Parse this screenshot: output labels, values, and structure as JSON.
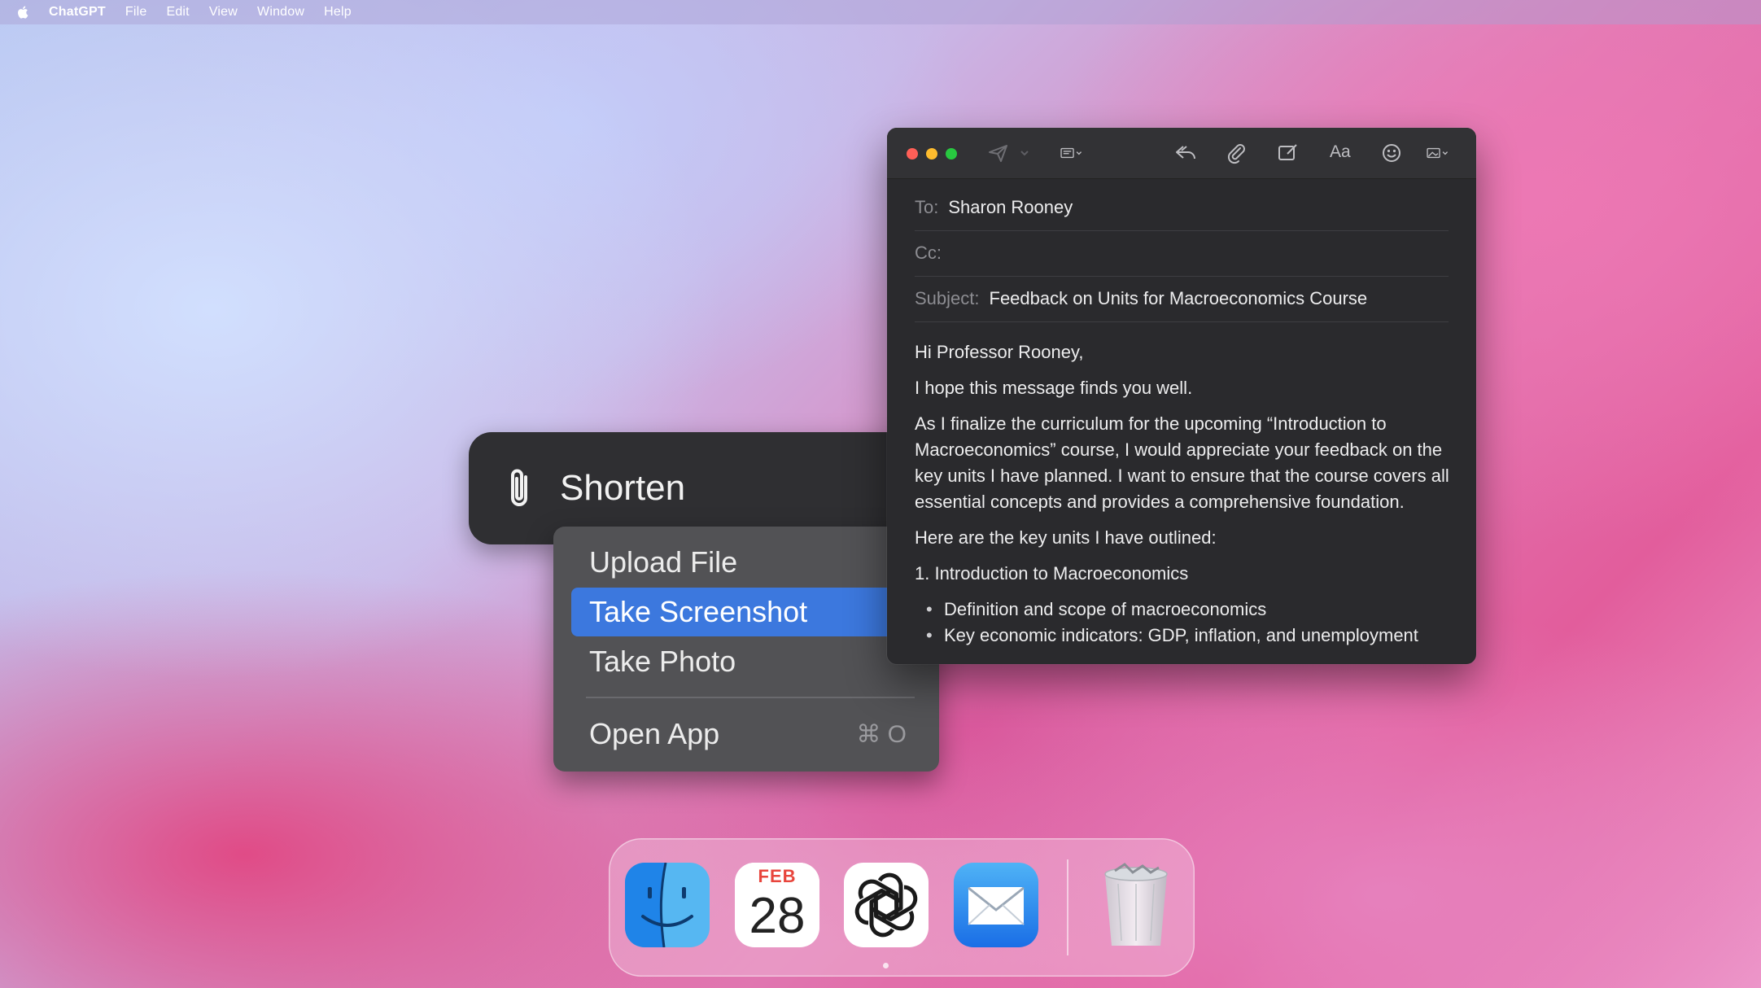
{
  "menubar": {
    "app_name": "ChatGPT",
    "items": [
      "File",
      "Edit",
      "View",
      "Window",
      "Help"
    ],
    "apple_icon": "apple-logo-icon"
  },
  "shorten_panel": {
    "label": "Shorten",
    "icon": "paperclip-icon"
  },
  "attach_menu": {
    "items": [
      {
        "label": "Upload File",
        "selected": false
      },
      {
        "label": "Take Screenshot",
        "selected": true
      },
      {
        "label": "Take Photo",
        "selected": false
      }
    ],
    "open_app": {
      "label": "Open App",
      "shortcut": "⌘ O"
    },
    "selected_color": "#3c78de"
  },
  "mail": {
    "toolbar": {
      "icons": [
        "send-icon",
        "chevron-down-icon",
        "header-fields-icon",
        "reply-icon",
        "attach-icon",
        "markup-icon",
        "format-icon",
        "emoji-icon",
        "photo-browser-icon"
      ],
      "format_label": "Aa"
    },
    "to_label": "To:",
    "to_value": "Sharon Rooney",
    "cc_label": "Cc:",
    "cc_value": "",
    "subject_label": "Subject:",
    "subject_value": "Feedback on Units for Macroeconomics Course",
    "body": {
      "greeting": "Hi Professor Rooney,",
      "p1": "I hope this message finds you well.",
      "p2": "As I finalize the curriculum for the upcoming “Introduction to Macroeconomics” course, I would appreciate your feedback on the key units I have planned. I want to ensure that the course covers all essential concepts and provides a comprehensive foundation.",
      "p3": "Here are the key units I have outlined:",
      "unit1": "1. Introduction to Macroeconomics",
      "bullets": [
        "Definition and scope of macroeconomics",
        "Key economic indicators: GDP, inflation, and unemployment"
      ]
    }
  },
  "dock": {
    "apps": [
      "finder-icon",
      "calendar-icon",
      "chatgpt-icon",
      "mail-icon",
      "trash-icon"
    ],
    "calendar_month": "FEB",
    "calendar_day": "28"
  }
}
